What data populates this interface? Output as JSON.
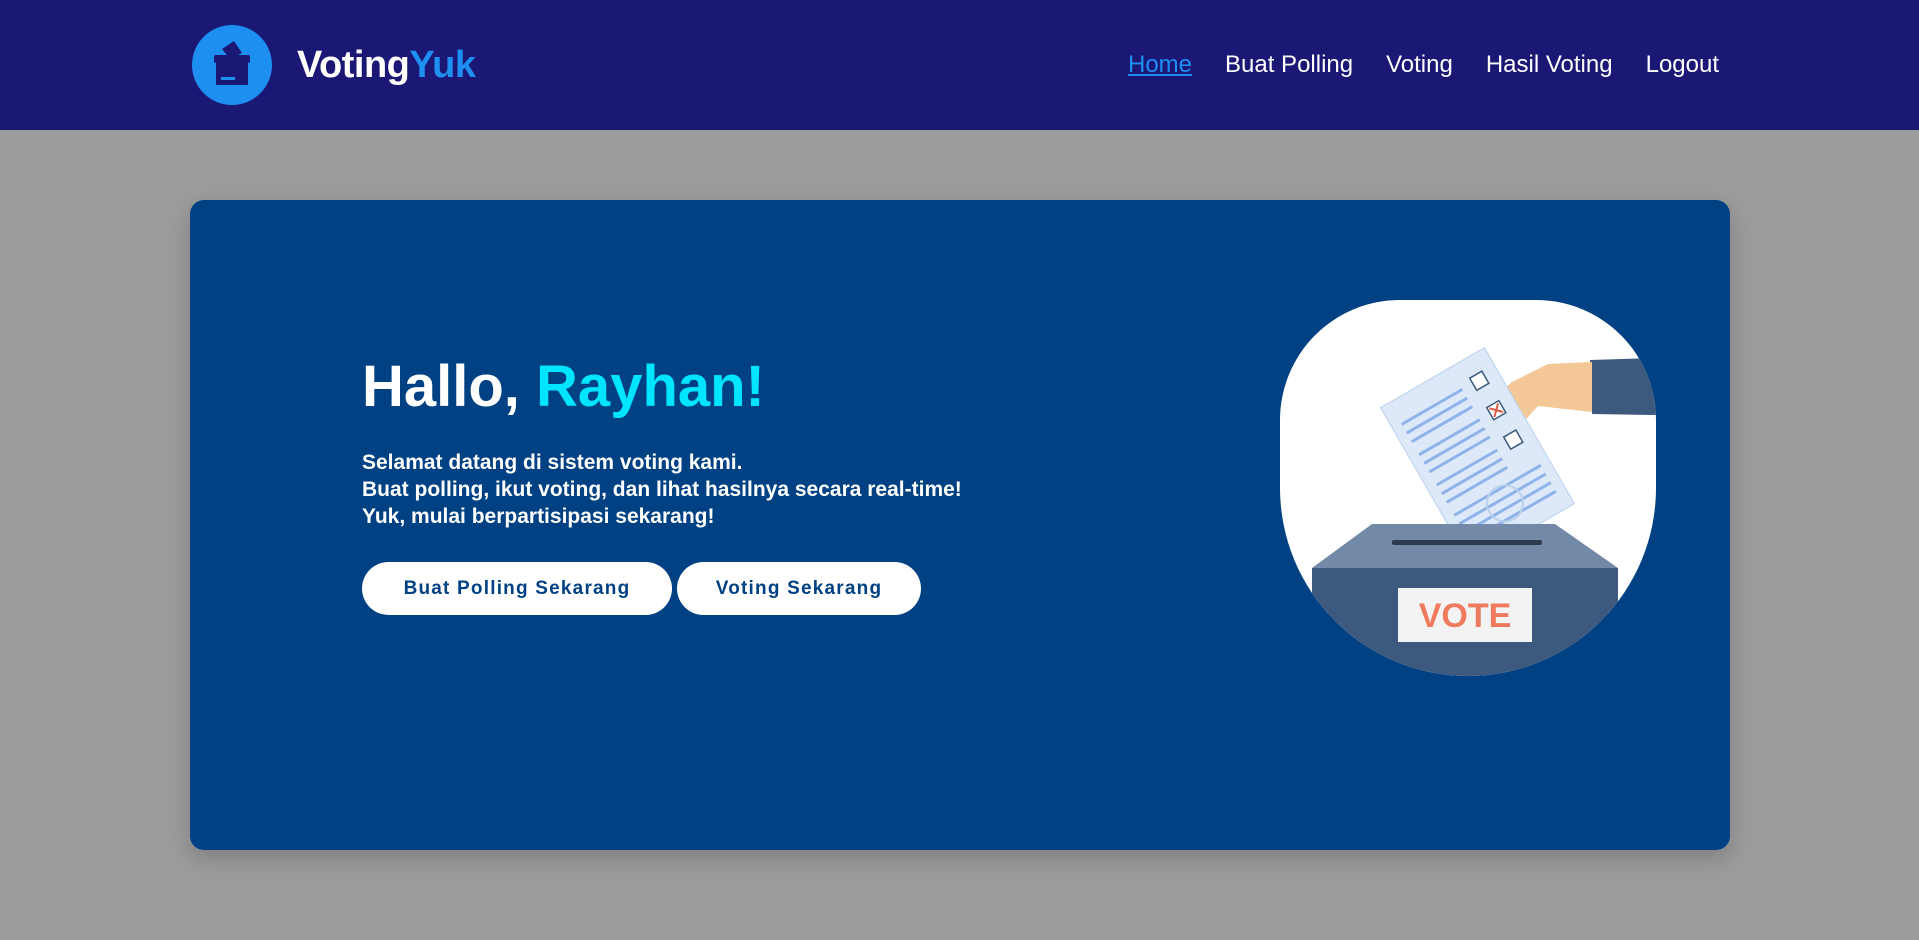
{
  "brand": {
    "name_part1": "Voting",
    "name_part2": "Yuk",
    "logo_icon": "ballot-box-icon"
  },
  "nav": {
    "items": [
      {
        "label": "Home",
        "active": true
      },
      {
        "label": "Buat Polling",
        "active": false
      },
      {
        "label": "Voting",
        "active": false
      },
      {
        "label": "Hasil Voting",
        "active": false
      },
      {
        "label": "Logout",
        "active": false
      }
    ]
  },
  "hero": {
    "greeting": "Hallo,",
    "user_name": "Rayhan!",
    "intro_lines": [
      "Selamat datang di sistem voting kami.",
      "Buat polling, ikut voting, dan lihat hasilnya secara real-time!",
      "Yuk, mulai berpartisipasi sekarang!"
    ],
    "buttons": {
      "create_poll": "Buat Polling Sekarang",
      "vote_now": "Voting Sekarang"
    },
    "illustration": {
      "icon": "vote-box-hand-icon",
      "box_label": "VOTE"
    }
  },
  "colors": {
    "navbar_bg": "#1b1774",
    "accent_blue": "#1c8ff1",
    "hero_bg": "#004183",
    "name_highlight": "#00e5ff",
    "page_bg": "#9b9b9b",
    "vote_label": "#ef7a5e"
  }
}
